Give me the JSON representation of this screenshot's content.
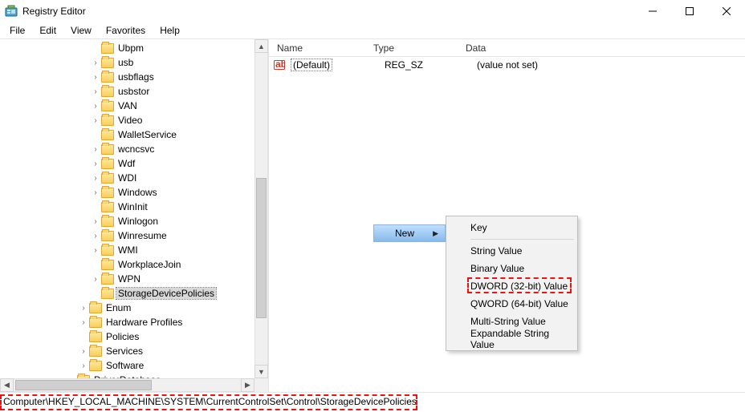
{
  "window": {
    "title": "Registry Editor"
  },
  "menus": [
    "File",
    "Edit",
    "View",
    "Favorites",
    "Help"
  ],
  "tree": {
    "indent_levels": {
      "level2": 113,
      "level1": 98,
      "level0": 83
    },
    "items": [
      {
        "label": "Ubpm",
        "chev": "none",
        "level": 2
      },
      {
        "label": "usb",
        "chev": "right",
        "level": 2
      },
      {
        "label": "usbflags",
        "chev": "right",
        "level": 2
      },
      {
        "label": "usbstor",
        "chev": "right",
        "level": 2
      },
      {
        "label": "VAN",
        "chev": "right",
        "level": 2
      },
      {
        "label": "Video",
        "chev": "right",
        "level": 2
      },
      {
        "label": "WalletService",
        "chev": "none",
        "level": 2
      },
      {
        "label": "wcncsvc",
        "chev": "right",
        "level": 2
      },
      {
        "label": "Wdf",
        "chev": "right",
        "level": 2
      },
      {
        "label": "WDI",
        "chev": "right",
        "level": 2
      },
      {
        "label": "Windows",
        "chev": "right",
        "level": 2
      },
      {
        "label": "WinInit",
        "chev": "none",
        "level": 2
      },
      {
        "label": "Winlogon",
        "chev": "right",
        "level": 2
      },
      {
        "label": "Winresume",
        "chev": "right",
        "level": 2
      },
      {
        "label": "WMI",
        "chev": "right",
        "level": 2
      },
      {
        "label": "WorkplaceJoin",
        "chev": "none",
        "level": 2
      },
      {
        "label": "WPN",
        "chev": "right",
        "level": 2
      },
      {
        "label": "StorageDevicePolicies",
        "chev": "none",
        "level": 2,
        "selected": true
      },
      {
        "label": "Enum",
        "chev": "right",
        "level": 1
      },
      {
        "label": "Hardware Profiles",
        "chev": "right",
        "level": 1
      },
      {
        "label": "Policies",
        "chev": "none",
        "level": 1
      },
      {
        "label": "Services",
        "chev": "right",
        "level": 1
      },
      {
        "label": "Software",
        "chev": "right",
        "level": 1
      },
      {
        "label": "DriverDatabase",
        "chev": "right",
        "level": 0
      }
    ]
  },
  "list": {
    "headers": {
      "name": "Name",
      "type": "Type",
      "data": "Data"
    },
    "rows": [
      {
        "name": "(Default)",
        "type": "REG_SZ",
        "data": "(value not set)"
      }
    ]
  },
  "context_menu": {
    "parent_label": "New",
    "items": [
      {
        "label": "Key"
      },
      {
        "sep": true
      },
      {
        "label": "String Value"
      },
      {
        "label": "Binary Value"
      },
      {
        "label": "DWORD (32-bit) Value",
        "highlighted": true
      },
      {
        "label": "QWORD (64-bit) Value"
      },
      {
        "label": "Multi-String Value"
      },
      {
        "label": "Expandable String Value"
      }
    ]
  },
  "statusbar": {
    "path": "Computer\\HKEY_LOCAL_MACHINE\\SYSTEM\\CurrentControlSet\\Control\\StorageDevicePolicies"
  }
}
